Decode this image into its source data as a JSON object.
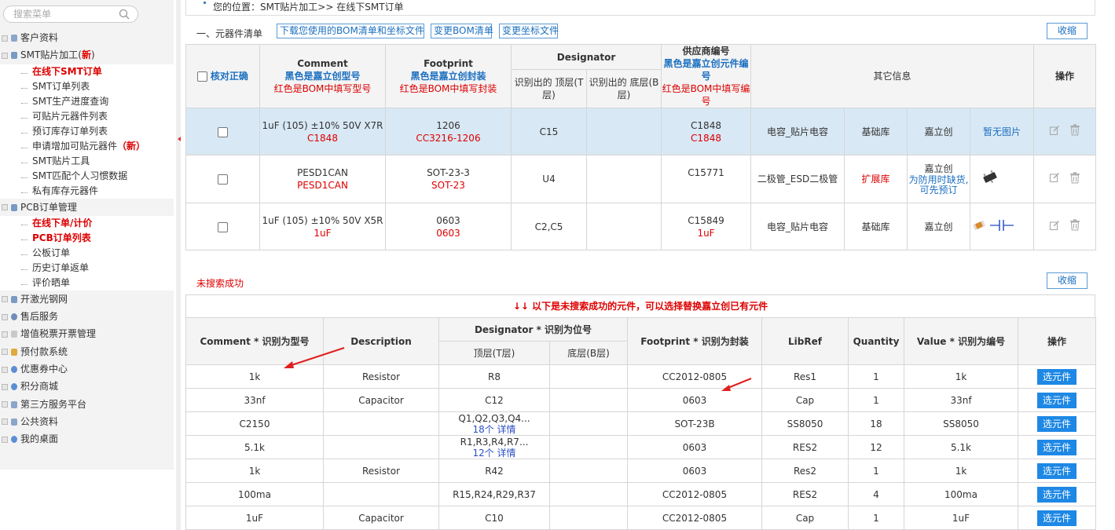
{
  "sidebar": {
    "search_placeholder": "搜索菜单",
    "groups": [
      {
        "label": "客户资料"
      },
      {
        "label": "SMT贴片加工(",
        "badge": "新",
        "suffix": ")"
      },
      {
        "label": "PCB订单管理"
      },
      {
        "label": "开激光钢网"
      },
      {
        "label": "售后服务"
      },
      {
        "label": "增值税票开票管理"
      },
      {
        "label": "预付款系统"
      },
      {
        "label": "优惠券中心"
      },
      {
        "label": "积分商城"
      },
      {
        "label": "第三方服务平台"
      },
      {
        "label": "公共资料"
      },
      {
        "label": "我的桌面"
      }
    ],
    "smt_items": [
      {
        "label": "在线下SMT订单"
      },
      {
        "label": "SMT订单列表"
      },
      {
        "label": "SMT生产进度查询"
      },
      {
        "label": "可贴片元器件列表"
      },
      {
        "label": "预订库存订单列表"
      },
      {
        "label": "申请增加可贴元器件",
        "badge": "（新）"
      },
      {
        "label": "SMT贴片工具"
      },
      {
        "label": "SMT匹配个人习惯数据"
      },
      {
        "label": "私有库存元器件"
      }
    ],
    "pcb_items": [
      {
        "label": "在线下单/计价"
      },
      {
        "label": "PCB订单列表"
      },
      {
        "label": "公板订单"
      },
      {
        "label": "历史订单返单"
      },
      {
        "label": "评价晒单"
      }
    ]
  },
  "breadcrumb": "您的位置：SMT贴片加工>> 在线下SMT订单",
  "bom_section": {
    "title": "一、元器件清单",
    "download_link": "下载您使用的BOM清单和坐标文件",
    "change_bom": "变更BOM清单",
    "change_coords": "变更坐标文件",
    "fold": "收缩",
    "headers": {
      "check": "核对正确",
      "comment_title": "Comment",
      "comment_black": "黑色是嘉立创型号",
      "comment_red": "红色是BOM中填写型号",
      "footprint_title": "Footprint",
      "footprint_black": "黑色是嘉立创封装",
      "footprint_red": "红色是BOM中填写封装",
      "designator_title": "Designator",
      "desig_top": "识别出的 顶层(T层)",
      "desig_bottom": "识别出的 底层(B层)",
      "supplier_title": "供应商编号",
      "supplier_black": "黑色是嘉立创元件编号",
      "supplier_red": "红色是BOM中填写编号",
      "other": "其它信息",
      "action": "操作"
    },
    "rows": [
      {
        "comment": "1uF (105) ±10% 50V X7R",
        "comment_bom": "C1848",
        "footprint": "1206",
        "footprint_bom": "CC3216-1206",
        "top": "C15",
        "bottom": "",
        "code": "C1848",
        "code_bom": "C1848",
        "category": "电容_贴片电容",
        "library": "基础库",
        "supplier": "嘉立创",
        "supplier_note": "",
        "image": "暂无图片",
        "image_type": "none",
        "highlight": true
      },
      {
        "comment": "PESD1CAN",
        "comment_bom": "PESD1CAN",
        "footprint": "SOT-23-3",
        "footprint_bom": "SOT-23",
        "top": "U4",
        "bottom": "",
        "code": "C15771",
        "code_bom": "",
        "category": "二极管_ESD二极管",
        "library": "扩展库",
        "supplier": "嘉立创",
        "supplier_note": "为防用时缺货,可先预订",
        "image": "",
        "image_type": "sot23",
        "highlight": false
      },
      {
        "comment": "1uF (105) ±10% 50V X5R",
        "comment_bom": "1uF",
        "footprint": "0603",
        "footprint_bom": "0603",
        "top": "C2,C5",
        "bottom": "",
        "code": "C15849",
        "code_bom": "1uF",
        "category": "电容_贴片电容",
        "library": "基础库",
        "supplier": "嘉立创",
        "supplier_note": "",
        "image": "",
        "image_type": "cap",
        "highlight": false
      }
    ]
  },
  "fail_section": {
    "title": "未搜索成功",
    "fold": "收缩",
    "warning": "↓↓ 以下是未搜索成功的元件，可以选择替换嘉立创已有元件",
    "headers": {
      "comment": "Comment * 识别为型号",
      "description": "Description",
      "designator": "Designator * 识别为位号",
      "top": "顶层(T层)",
      "bottom": "底层(B层)",
      "footprint": "Footprint * 识别为封装",
      "libref": "LibRef",
      "quantity": "Quantity",
      "value": "Value *  识别为编号",
      "action": "操作"
    },
    "select_label": "选元件",
    "rows": [
      {
        "comment": "1k",
        "description": "Resistor",
        "top": "R8",
        "detail": "",
        "footprint": "CC2012-0805",
        "libref": "Res1",
        "quantity": "1",
        "value": "1k"
      },
      {
        "comment": "33nf",
        "description": "Capacitor",
        "top": "C12",
        "detail": "",
        "footprint": "0603",
        "libref": "Cap",
        "quantity": "1",
        "value": "33nf"
      },
      {
        "comment": "C2150",
        "description": "",
        "top": "Q1,Q2,Q3,Q4...",
        "detail": "18个  详情",
        "footprint": "SOT-23B",
        "libref": "SS8050",
        "quantity": "18",
        "value": "SS8050"
      },
      {
        "comment": "5.1k",
        "description": "",
        "top": "R1,R3,R4,R7...",
        "detail": "12个  详情",
        "footprint": "0603",
        "libref": "RES2",
        "quantity": "12",
        "value": "5.1k"
      },
      {
        "comment": "1k",
        "description": "Resistor",
        "top": "R42",
        "detail": "",
        "footprint": "0603",
        "libref": "Res2",
        "quantity": "1",
        "value": "1k"
      },
      {
        "comment": "100ma",
        "description": "",
        "top": "R15,R24,R29,R37",
        "detail": "",
        "footprint": "CC2012-0805",
        "libref": "RES2",
        "quantity": "4",
        "value": "100ma"
      },
      {
        "comment": "1uF",
        "description": "Capacitor",
        "top": "C10",
        "detail": "",
        "footprint": "CC2012-0805",
        "libref": "Cap",
        "quantity": "1",
        "value": "1uF"
      }
    ]
  },
  "colors": {
    "accent": "#1e88e5",
    "warn": "#dd0000",
    "highlight_row": "#d8e8f5",
    "link": "#1b6fc0"
  }
}
